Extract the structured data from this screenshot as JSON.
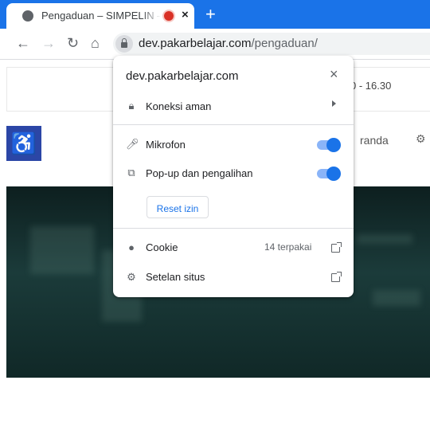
{
  "browser": {
    "tab": {
      "title": "Pengaduan – SIMPELIN – Pengaduan",
      "close_label": "×"
    },
    "new_tab_label": "+",
    "url_domain": "dev.pakarbelajar.com",
    "url_path": "/pengaduan/",
    "accent": "#1a73e8"
  },
  "page": {
    "hours": "0 - 16.30",
    "nav_item": "randa",
    "accessibility_icon": "accessibility-icon",
    "accessibility_glyph": "♿"
  },
  "site_info_popup": {
    "domain": "dev.pakarbelajar.com",
    "close_label": "×",
    "connection_label": "Koneksi aman",
    "permissions": [
      {
        "label": "Mikrofon",
        "icon": "microphone-icon",
        "enabled": true
      },
      {
        "label": "Pop-up dan pengalihan",
        "icon": "popup-icon",
        "enabled": true
      }
    ],
    "reset_label": "Reset izin",
    "cookie_label": "Cookie",
    "cookie_count": "14 terpakai",
    "site_settings_label": "Setelan situs"
  }
}
